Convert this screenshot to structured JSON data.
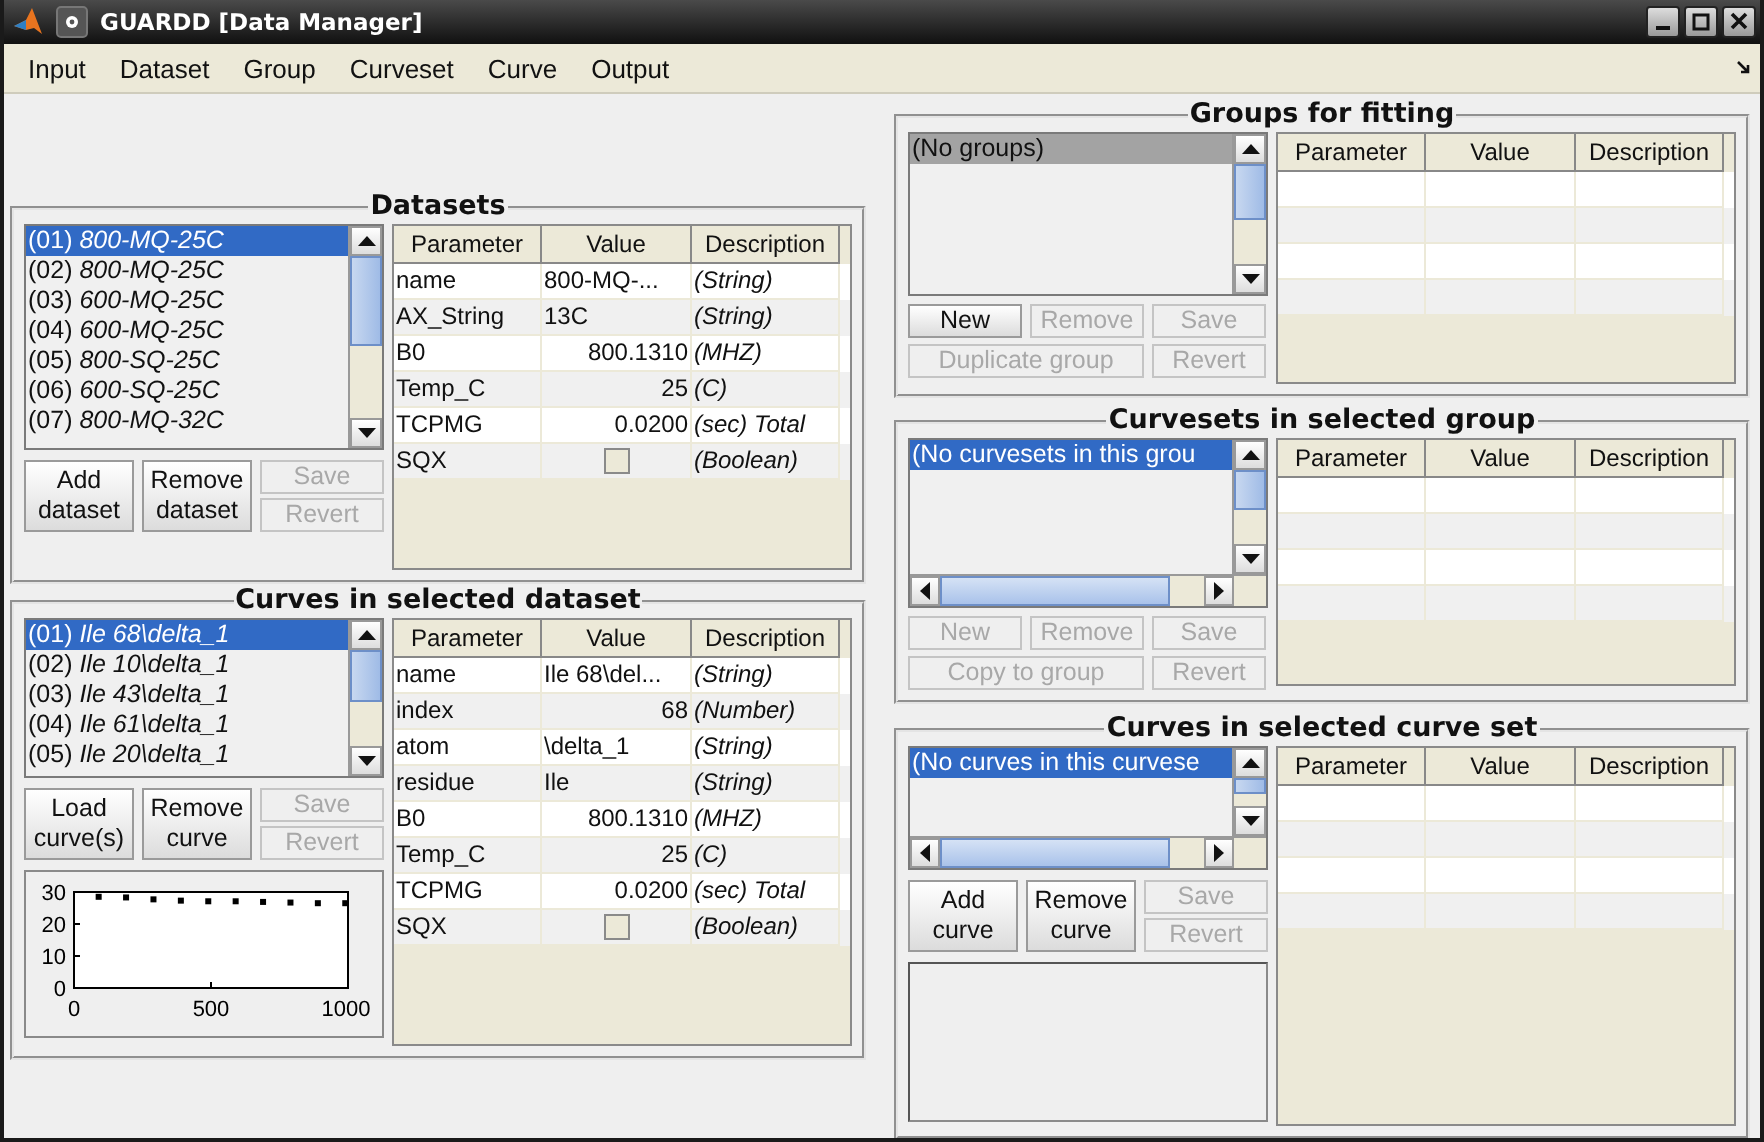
{
  "window": {
    "title": "GUARDD [Data Manager]"
  },
  "menu": [
    "Input",
    "Dataset",
    "Group",
    "Curveset",
    "Curve",
    "Output"
  ],
  "datasets": {
    "title": "Datasets",
    "list": {
      "focused": true,
      "items": [
        {
          "label": "(01) *800-MQ-25C*",
          "selected": true
        },
        {
          "label": "(02) *800-MQ-25C*",
          "selected": false
        },
        {
          "label": "(03) *600-MQ-25C*",
          "selected": false
        },
        {
          "label": "(04) *600-MQ-25C*",
          "selected": false
        },
        {
          "label": "(05) *800-SQ-25C*",
          "selected": false
        },
        {
          "label": "(06) *600-SQ-25C*",
          "selected": false
        },
        {
          "label": "(07) *800-MQ-32C*",
          "selected": false
        }
      ]
    },
    "buttons": [
      {
        "label": "Add dataset",
        "disabled": false
      },
      {
        "label": "Remove dataset",
        "disabled": false
      },
      {
        "label": "Save",
        "disabled": true
      },
      {
        "label": "Revert",
        "disabled": true
      }
    ],
    "table": {
      "columns": [
        "Parameter",
        "Value",
        "Description"
      ],
      "rows": [
        {
          "kind": "text",
          "parameter": "name",
          "value": "800-MQ-...",
          "description": "(String)"
        },
        {
          "kind": "text",
          "parameter": "AX_String",
          "value": "13C",
          "description": "(String)"
        },
        {
          "kind": "number",
          "parameter": "B0",
          "value": "800.1310",
          "description": "(MHZ)"
        },
        {
          "kind": "number",
          "parameter": "Temp_C",
          "value": "25",
          "description": "(C)"
        },
        {
          "kind": "number",
          "parameter": "TCPMG",
          "value": "0.0200",
          "description": "(sec) Total"
        },
        {
          "kind": "checkbox",
          "parameter": "SQX",
          "checked": false,
          "description": "(Boolean)"
        }
      ]
    }
  },
  "curves_in_dataset": {
    "title": "Curves in selected dataset",
    "list": {
      "focused": true,
      "items": [
        {
          "label": "(01) *Ile 68\\delta_1*",
          "selected": true
        },
        {
          "label": "(02) *Ile 10\\delta_1*",
          "selected": false
        },
        {
          "label": "(03) *Ile 43\\delta_1*",
          "selected": false
        },
        {
          "label": "(04) *Ile 61\\delta_1*",
          "selected": false
        },
        {
          "label": "(05) *Ile 20\\delta_1*",
          "selected": false
        }
      ]
    },
    "buttons": [
      {
        "label": "Load curve(s)",
        "disabled": false
      },
      {
        "label": "Remove curve",
        "disabled": false
      },
      {
        "label": "Save",
        "disabled": true
      },
      {
        "label": "Revert",
        "disabled": true
      }
    ],
    "chart_data": {
      "type": "scatter",
      "x": [
        90,
        190,
        290,
        390,
        490,
        590,
        690,
        790,
        890,
        990
      ],
      "series": [
        {
          "color": "#000000",
          "values": [
            28.5,
            28.3,
            27.7,
            27.3,
            27.1,
            27.1,
            26.9,
            26.7,
            26.5,
            26.5
          ]
        }
      ],
      "xlim": [
        0,
        1000
      ],
      "ylim": [
        0,
        30
      ],
      "xticks": [
        0,
        500,
        1000
      ],
      "yticks": [
        0,
        10,
        20,
        30
      ]
    },
    "table": {
      "columns": [
        "Parameter",
        "Value",
        "Description"
      ],
      "rows": [
        {
          "kind": "text",
          "parameter": "name",
          "value": "Ile 68\\del...",
          "description": "(String)"
        },
        {
          "kind": "number",
          "parameter": "index",
          "value": "68",
          "description": "(Number)"
        },
        {
          "kind": "text",
          "parameter": "atom",
          "value": "\\delta_1",
          "description": "(String)"
        },
        {
          "kind": "text",
          "parameter": "residue",
          "value": "Ile",
          "description": "(String)"
        },
        {
          "kind": "number",
          "parameter": "B0",
          "value": "800.1310",
          "description": "(MHZ)"
        },
        {
          "kind": "number",
          "parameter": "Temp_C",
          "value": "25",
          "description": "(C)"
        },
        {
          "kind": "number",
          "parameter": "TCPMG",
          "value": "0.0200",
          "description": "(sec) Total"
        },
        {
          "kind": "checkbox",
          "parameter": "SQX",
          "checked": false,
          "description": "(Boolean)"
        }
      ]
    }
  },
  "groups": {
    "title": "Groups for fitting",
    "list": {
      "focused": false,
      "items": [
        {
          "label": "(No groups)",
          "selected": true
        }
      ]
    },
    "buttons": [
      {
        "label": "New",
        "disabled": false
      },
      {
        "label": "Remove",
        "disabled": true
      },
      {
        "label": "Save",
        "disabled": true
      },
      {
        "label": "Duplicate group",
        "disabled": true
      },
      {
        "label": "Revert",
        "disabled": true
      }
    ],
    "table": {
      "columns": [
        "Parameter",
        "Value",
        "Description"
      ]
    }
  },
  "curvesets": {
    "title": "Curvesets in selected group",
    "list": {
      "focused": true,
      "items": [
        {
          "label": "(No curvesets in this grou",
          "selected": true
        }
      ]
    },
    "buttons": [
      {
        "label": "New",
        "disabled": true
      },
      {
        "label": "Remove",
        "disabled": true
      },
      {
        "label": "Save",
        "disabled": true
      },
      {
        "label": "Copy to group",
        "disabled": true
      },
      {
        "label": "Revert",
        "disabled": true
      }
    ],
    "table": {
      "columns": [
        "Parameter",
        "Value",
        "Description"
      ]
    }
  },
  "curves_in_curveset": {
    "title": "Curves in selected curve set",
    "list": {
      "focused": true,
      "items": [
        {
          "label": "(No curves in this curvese",
          "selected": true
        }
      ]
    },
    "buttons": [
      {
        "label": "Add curve",
        "disabled": false
      },
      {
        "label": "Remove curve",
        "disabled": false
      },
      {
        "label": "Save",
        "disabled": true
      },
      {
        "label": "Revert",
        "disabled": true
      }
    ],
    "table": {
      "columns": [
        "Parameter",
        "Value",
        "Description"
      ]
    }
  }
}
